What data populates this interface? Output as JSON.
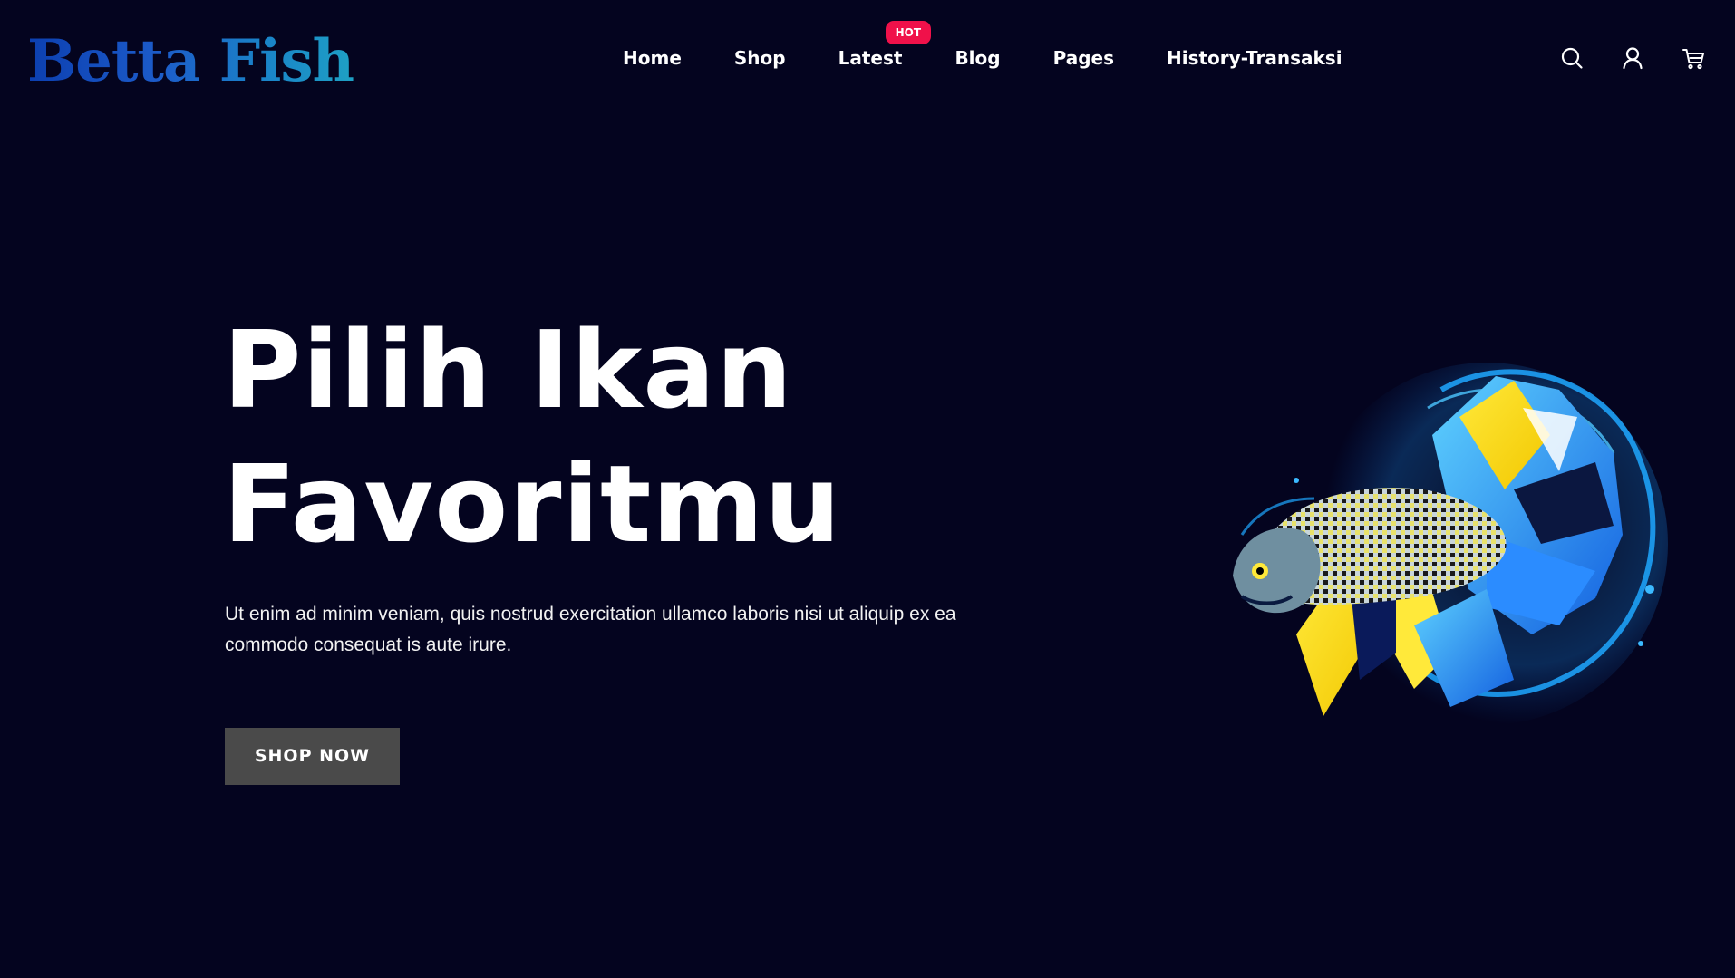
{
  "header": {
    "logo_text": "Betta Fish",
    "nav": [
      {
        "label": "Home"
      },
      {
        "label": "Shop"
      },
      {
        "label": "Latest",
        "badge": "HOT"
      },
      {
        "label": "Blog"
      },
      {
        "label": "Pages"
      },
      {
        "label": "History-Transaksi"
      }
    ],
    "icons": [
      "search-icon",
      "user-icon",
      "cart-icon"
    ]
  },
  "hero": {
    "title_line1": "Pilih Ikan",
    "title_line2": "Favoritmu",
    "description": "Ut enim ad minim veniam, quis nostrud exercitation ullamco laboris nisi ut aliquip ex ea commodo consequat is aute irure.",
    "cta_label": "SHOP NOW"
  },
  "colors": {
    "background": "#04041f",
    "badge": "#f0114a",
    "button": "#4a4a4a",
    "logo_gradient_start": "#0c3fb0",
    "logo_gradient_end": "#1ea0c4"
  }
}
